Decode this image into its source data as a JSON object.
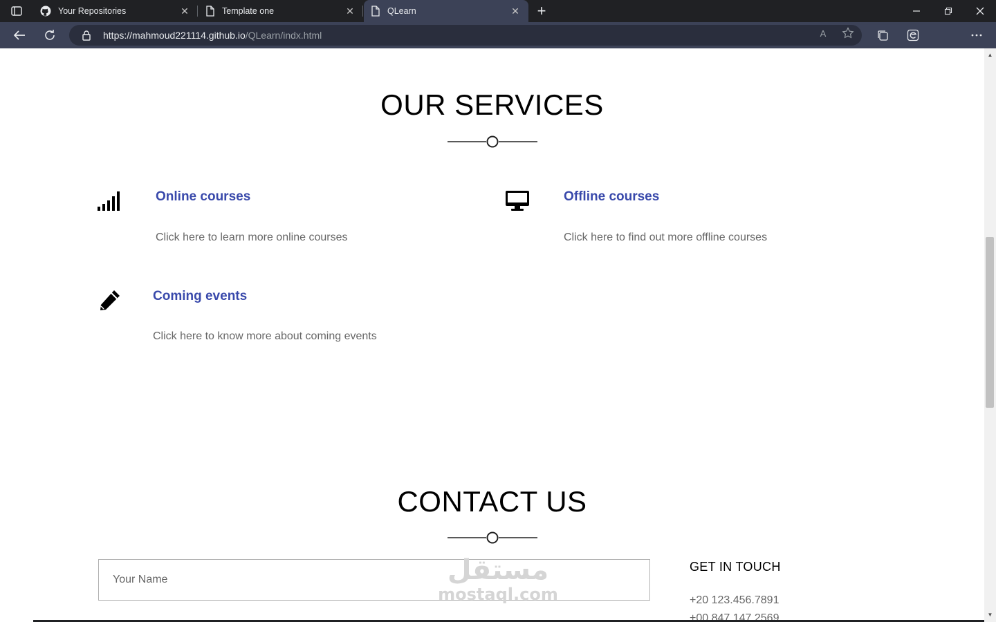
{
  "browser": {
    "tabs": [
      {
        "title": "Your Repositories",
        "icon": "github-icon",
        "active": false
      },
      {
        "title": "Template one",
        "icon": "page-icon",
        "active": false
      },
      {
        "title": "QLearn",
        "icon": "page-icon",
        "active": true
      }
    ],
    "url_host": "https://mahmoud221114.github.io",
    "url_path": "/QLearn/indx.html",
    "read_aloud_label": "A"
  },
  "services": {
    "title": "OUR SERVICES",
    "items": [
      {
        "title": "Online courses",
        "description": "Click here to learn more online courses",
        "icon": "signal-icon"
      },
      {
        "title": "Offline courses",
        "description": "Click here to find out more offline courses",
        "icon": "desktop-icon"
      },
      {
        "title": "Coming events",
        "description": "Click here to know more about coming events",
        "icon": "pencil-icon"
      }
    ]
  },
  "contact": {
    "title": "CONTACT US",
    "name_placeholder": "Your Name",
    "get_in_touch": "GET IN TOUCH",
    "phones": [
      "+20 123.456.7891",
      "+00 847 147 2569"
    ]
  },
  "watermark": {
    "arabic": "مستقل",
    "latin": "mostaql.com"
  },
  "colors": {
    "accent": "#3949ab",
    "chrome_dark": "#202124",
    "chrome": "#3c4257"
  }
}
